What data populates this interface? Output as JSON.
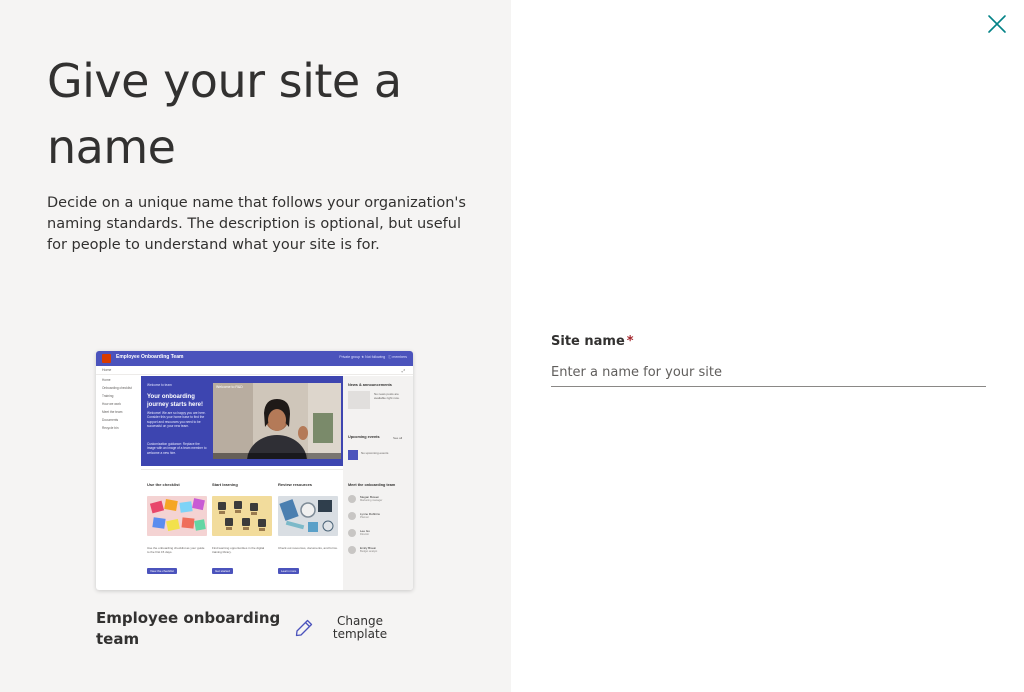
{
  "dialog": {
    "title": "Give your site a name",
    "description": "Decide on a unique name that follows your organization's naming standards. The description is optional, but useful for people to understand what your site is for.",
    "close_icon": "close-icon"
  },
  "preview": {
    "site_title": "Employee Onboarding Team",
    "header_links": "Private group  ★ Not following   ⓘ members",
    "command_home": "Home",
    "nav": [
      "Home",
      "Onboarding checklist",
      "Training",
      "How we work",
      "Meet the team",
      "Documents",
      "Recycle bin"
    ],
    "hero": {
      "kicker": "Welcome to team",
      "title": "Your onboarding journey starts here!",
      "body": "Welcome! We are so happy you are here. Consider this your home base to find the support and resources you need to be successful on your new team.",
      "guidance": "Customization guidance: Replace the image with an image of a team member to welcome a new hire.",
      "video_label": "Welcome to R&D"
    },
    "columns": [
      {
        "title": "Use the checklist",
        "text": "Use the onboarding checklist as your guide to the first 15 days.",
        "button": "View the checklist"
      },
      {
        "title": "Start learning",
        "text": "Find learning opportunities in the digital training library.",
        "button": "Get started"
      },
      {
        "title": "Review resources",
        "text": "Check out resources, documents, and forms.",
        "button": "Learn more"
      }
    ],
    "sidebar": {
      "news_title": "News & announcements",
      "news_text": "No news posts are available right now.",
      "events_title": "Upcoming events",
      "events_see_all": "See all",
      "events_text": "No upcoming events",
      "team_title": "Meet the onboarding team",
      "people": [
        {
          "name": "Megan Bowen",
          "role": "Marketing manager"
        },
        {
          "name": "Lynne Robbins",
          "role": "Planner"
        },
        {
          "name": "Lee Gu",
          "role": "Director"
        },
        {
          "name": "Emily Braun",
          "role": "Budget analyst"
        }
      ]
    }
  },
  "template": {
    "name": "Employee onboarding team",
    "change_label": "Change template",
    "pencil_icon": "pencil-icon"
  },
  "form": {
    "site_name_label": "Site name",
    "required_marker": "*",
    "site_name_value": "",
    "site_name_placeholder": "Enter a name for your site"
  },
  "colors": {
    "left_panel_bg": "#f5f4f3",
    "accent": "#4b53bc",
    "close_icon": "#038387",
    "required": "#a4262c"
  }
}
